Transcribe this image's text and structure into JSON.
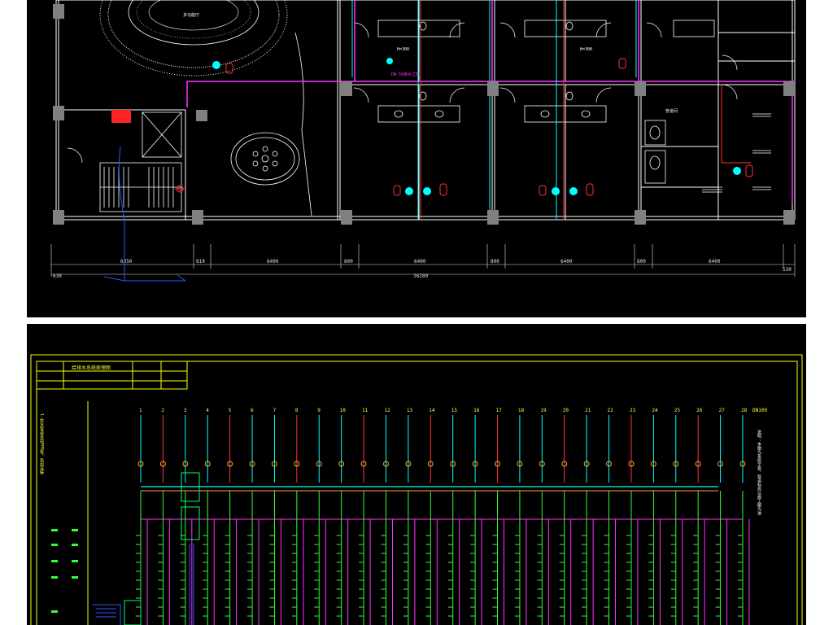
{
  "floor_plan": {
    "room_label": "多功能厅",
    "pipe_note": "DN-50排水立管",
    "room_note_1": "H=300",
    "room_note_2": "H=300",
    "storage_label": "管道间",
    "riser_tag": "①",
    "dimensions": [
      "6350",
      "810",
      "6400",
      "800",
      "6400",
      "800",
      "6400",
      "800",
      "6400",
      "530"
    ],
    "total_label": "36280",
    "left_offset": "630",
    "colors": {
      "background": "#000000",
      "walls": "#ffffff",
      "columns": "#808080",
      "drain_pipe": "#ff33ff",
      "water_pipe": "#00ffff",
      "fire_pipe": "#ff3333",
      "stair_riser": "#3355ff"
    }
  },
  "schematic": {
    "title": "给排水系统原理图",
    "column_labels": [
      "1",
      "2",
      "3",
      "4",
      "5",
      "6",
      "7",
      "8",
      "9",
      "10",
      "11",
      "12",
      "13",
      "14",
      "15",
      "16",
      "17",
      "18",
      "19",
      "20",
      "21",
      "22",
      "23",
      "24",
      "25",
      "26",
      "27",
      "28"
    ],
    "last_column_label": "DN100",
    "left_note": "1.给水管道采用PPR管，热熔连接",
    "right_note": "说明：本图为系统示意，管道标高以施工图为准",
    "colors": {
      "frame": "#ffff00",
      "supply": "#00ffff",
      "return": "#ff3333",
      "branch": "#33ff33",
      "manifold": "#ffaa33",
      "drain": "#ff33ff"
    }
  }
}
